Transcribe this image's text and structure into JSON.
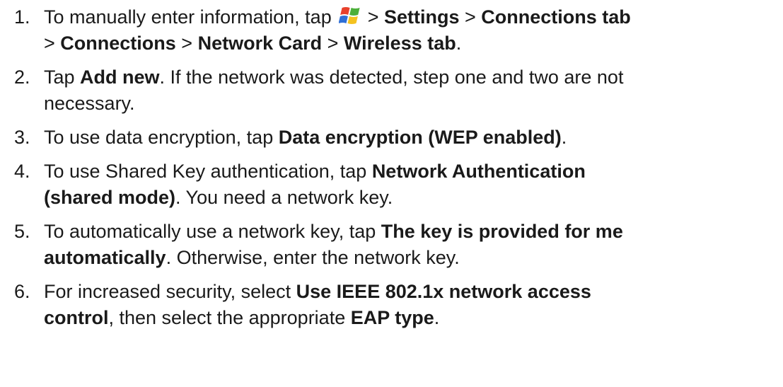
{
  "steps": [
    {
      "number": "1.",
      "line1": {
        "t1": "To manually enter information, tap ",
        "sep1": " > ",
        "b1": "Settings",
        "sep2": " > ",
        "b2": "Connections tab"
      },
      "line2": {
        "sep1": "> ",
        "b1": "Connections",
        "sep2": " > ",
        "b2": "Network Card",
        "sep3": " > ",
        "b3": "Wireless tab",
        "end": "."
      },
      "icon": "windows-start-icon"
    },
    {
      "number": "2.",
      "line1": {
        "t1": "Tap ",
        "b1": "Add new",
        "t2": ". If the network was detected, step one and two are not"
      },
      "line2": {
        "t1": "necessary."
      }
    },
    {
      "number": "3.",
      "line1": {
        "t1": "To use data encryption, tap ",
        "b1": "Data encryption (WEP enabled)",
        "end": "."
      }
    },
    {
      "number": "4.",
      "line1": {
        "t1": "To use Shared Key authentication, tap ",
        "b1": "Network Authentication"
      },
      "line2": {
        "b1": "(shared mode)",
        "t1": ". You need a network key."
      }
    },
    {
      "number": "5.",
      "line1": {
        "t1": "To automatically use a network key, tap ",
        "b1": "The key is provided for me"
      },
      "line2": {
        "b1": "automatically",
        "t1": ". Otherwise, enter the network key."
      }
    },
    {
      "number": "6.",
      "line1": {
        "t1": "For increased security, select ",
        "b1": "Use IEEE 802.1x network access"
      },
      "line2": {
        "b1": "control",
        "t1": ", then select the appropriate ",
        "b2": "EAP type",
        "end": "."
      }
    }
  ],
  "colors": {
    "text": "#1a1a1a",
    "icon_red": "#e8412c",
    "icon_green": "#4caf3a",
    "icon_blue": "#2f6fd6",
    "icon_yellow": "#f4c21f"
  }
}
